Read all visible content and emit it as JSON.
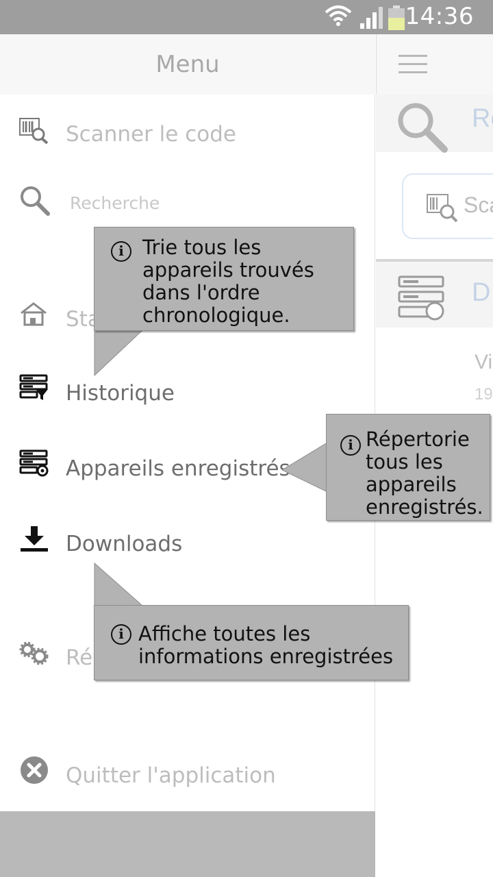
{
  "status_bar": {
    "time": "14:36"
  },
  "drawer": {
    "title": "Menu",
    "items": [
      {
        "label": "Scanner le code",
        "icon": "barcode-scan-icon"
      },
      {
        "label": "Recherche",
        "icon": "search-icon"
      },
      {
        "label": "Sta",
        "icon": "home-icon"
      },
      {
        "label": "Historique",
        "icon": "history-filter-icon"
      },
      {
        "label": "Appareils enregistrés",
        "icon": "registered-devices-icon"
      },
      {
        "label": "Downloads",
        "icon": "download-icon"
      },
      {
        "label": "Rég",
        "icon": "gear-icon"
      },
      {
        "label": "Quitter l'application",
        "icon": "close-circle-icon"
      }
    ]
  },
  "background": {
    "search_title": "Re",
    "scan_button": "Sca",
    "devices_title": "D",
    "row_line1": "Vi",
    "row_line2": "19"
  },
  "tooltips": {
    "historique": "Trie tous les\nappareils trouvés\ndans l'ordre\nchronologique.",
    "appareils": "Répertorie\ntous les\nappareils\nenregistrés.",
    "downloads": "Affiche toutes les\ninformations enregistrées"
  }
}
